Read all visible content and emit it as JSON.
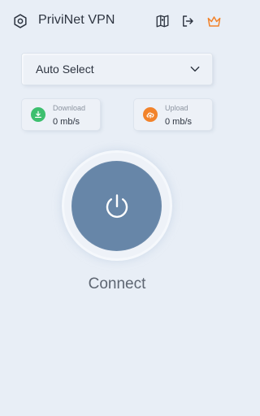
{
  "header": {
    "title": "PriviNet VPN",
    "icons": {
      "settings": "gear-icon",
      "map": "map-icon",
      "logout": "logout-icon",
      "premium": "crown-icon"
    }
  },
  "server_select": {
    "value": "Auto Select",
    "icon": "chevron-down-icon"
  },
  "stats": {
    "download": {
      "label": "Download",
      "value": "0 mb/s",
      "icon": "download-icon",
      "color": "#3dbf6e"
    },
    "upload": {
      "label": "Upload",
      "value": "0 mb/s",
      "icon": "cloud-upload-icon",
      "color": "#f2832b"
    }
  },
  "power": {
    "icon": "power-icon",
    "color": "#6786a8",
    "status_label": "Connect"
  },
  "colors": {
    "background": "#e8eef6",
    "premium_accent": "#f2832b"
  }
}
